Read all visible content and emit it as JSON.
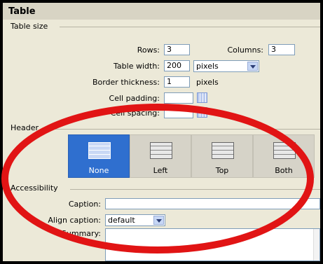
{
  "window": {
    "title": "Table"
  },
  "table_size": {
    "legend": "Table size",
    "rows_label": "Rows:",
    "rows_value": "3",
    "columns_label": "Columns:",
    "columns_value": "3",
    "table_width_label": "Table width:",
    "table_width_value": "200",
    "width_unit": "pixels",
    "border_label": "Border thickness:",
    "border_value": "1",
    "border_unit": "pixels",
    "cell_padding_label": "Cell padding:",
    "cell_padding_value": "",
    "cell_spacing_label": "Cell spacing:",
    "cell_spacing_value": ""
  },
  "header": {
    "legend": "Header",
    "options": [
      {
        "label": "None",
        "selected": true
      },
      {
        "label": "Left",
        "selected": false
      },
      {
        "label": "Top",
        "selected": false
      },
      {
        "label": "Both",
        "selected": false
      }
    ]
  },
  "accessibility": {
    "legend": "Accessibility",
    "caption_label": "Caption:",
    "caption_value": "",
    "align_caption_label": "Align caption:",
    "align_caption_value": "default",
    "summary_label": "Summary:"
  },
  "colors": {
    "selected": "#2f6fcf",
    "annotation": "#e11414"
  }
}
